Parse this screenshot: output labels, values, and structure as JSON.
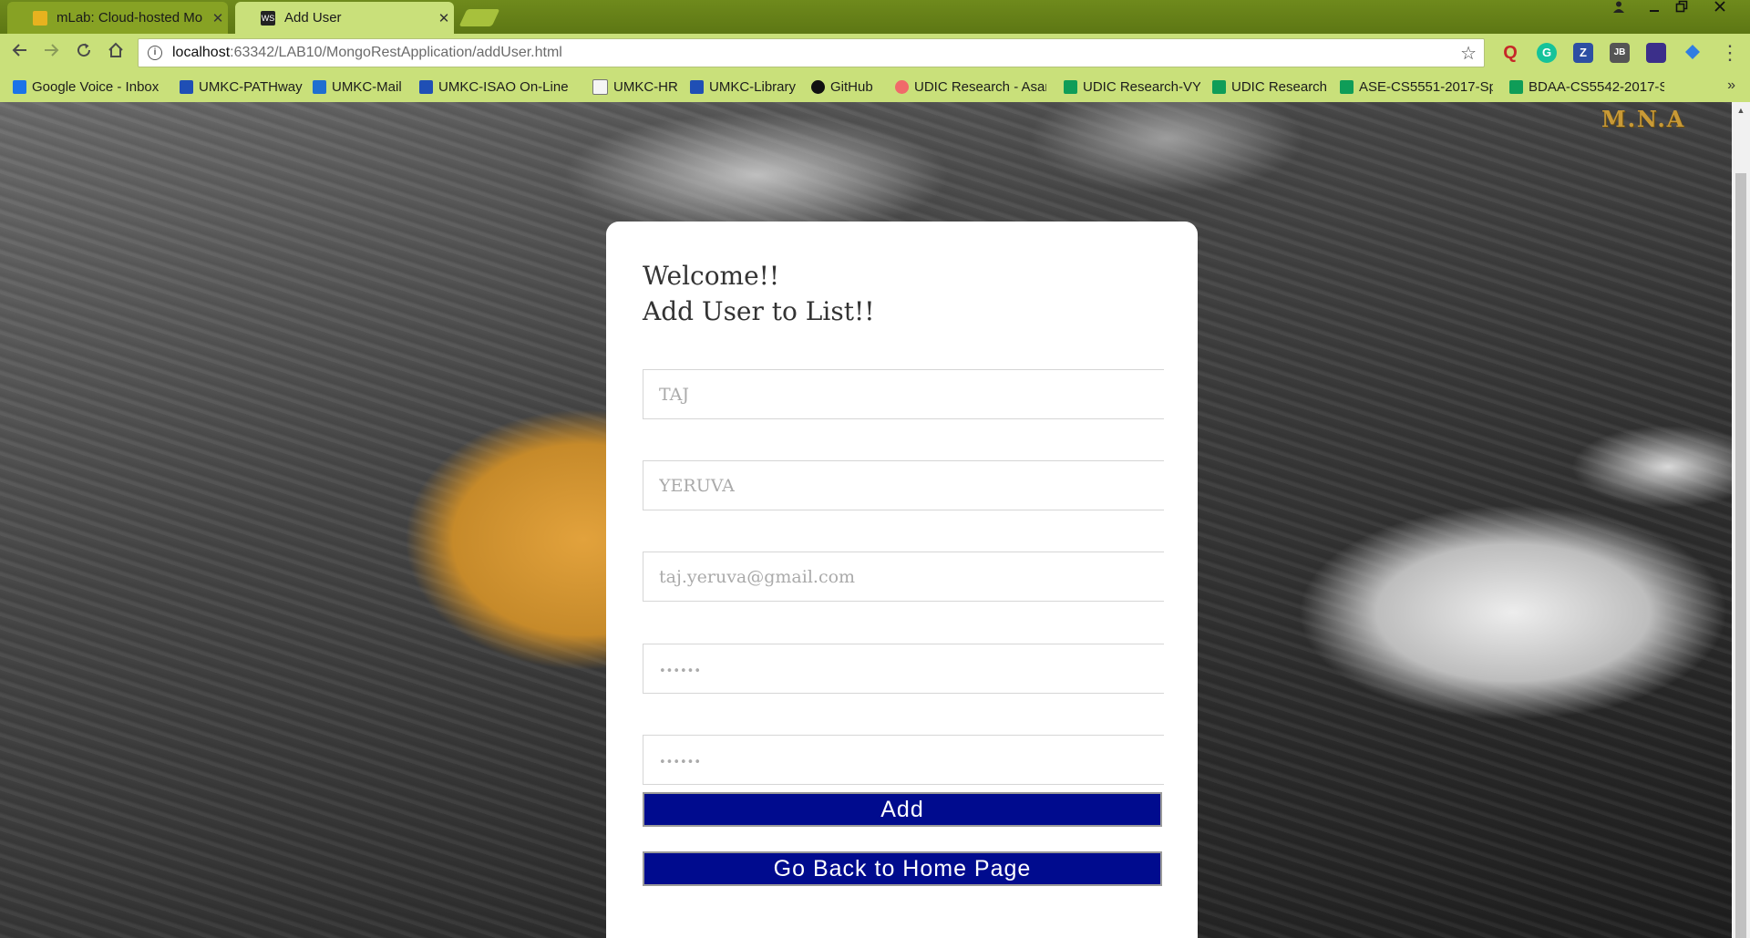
{
  "browser": {
    "tabs": [
      {
        "title": "mLab: Cloud-hosted Mo",
        "active": false,
        "favicon_color": "#e7b21f"
      },
      {
        "title": "Add User",
        "active": true,
        "favicon_color": "#222222"
      }
    ],
    "address": {
      "host": "localhost",
      "path": ":63342/LAB10/MongoRestApplication/addUser.html"
    },
    "bookmarks": [
      {
        "label": "Google Voice - Inbox",
        "icon_color": "#1a73e8"
      },
      {
        "label": "UMKC-PATHway",
        "icon_color": "#1f4fb5"
      },
      {
        "label": "UMKC-Mail",
        "icon_color": "#1e6fd0"
      },
      {
        "label": "UMKC-ISAO On-Line",
        "icon_color": "#1f4fb5"
      },
      {
        "label": "UMKC-HR",
        "icon_color": "#f5f5f5"
      },
      {
        "label": "UMKC-Library",
        "icon_color": "#1f4fb5"
      },
      {
        "label": "GitHub",
        "icon_color": "#111111"
      },
      {
        "label": "UDIC Research - Asan",
        "icon_color": "#f06a6a"
      },
      {
        "label": "UDIC Research-VY",
        "icon_color": "#0f9d58"
      },
      {
        "label": "UDIC Research",
        "icon_color": "#0f9d58"
      },
      {
        "label": "ASE-CS5551-2017-Sp",
        "icon_color": "#0f9d58"
      },
      {
        "label": "BDAA-CS5542-2017-S",
        "icon_color": "#0f9d58"
      }
    ],
    "extensions": [
      {
        "label": "Q",
        "color": "#c62828"
      },
      {
        "label": "G",
        "color": "#15c39a"
      },
      {
        "label": "Z",
        "color": "#2d4fa3"
      },
      {
        "label": "JB",
        "color": "#555555"
      },
      {
        "label": "",
        "color": "#3b2f8a"
      },
      {
        "label": "",
        "color": "#2f7de1"
      }
    ]
  },
  "page": {
    "logo": "M.N.A",
    "heading_line1": "Welcome!!",
    "heading_line2": "Add User to List!!",
    "fields": {
      "first_name_placeholder": "TAJ",
      "last_name_placeholder": "YERUVA",
      "email_placeholder": "taj.yeruva@gmail.com",
      "password_placeholder": "••••••",
      "confirm_password_placeholder": "••••••"
    },
    "add_button": "Add",
    "home_button": "Go Back to Home Page"
  }
}
